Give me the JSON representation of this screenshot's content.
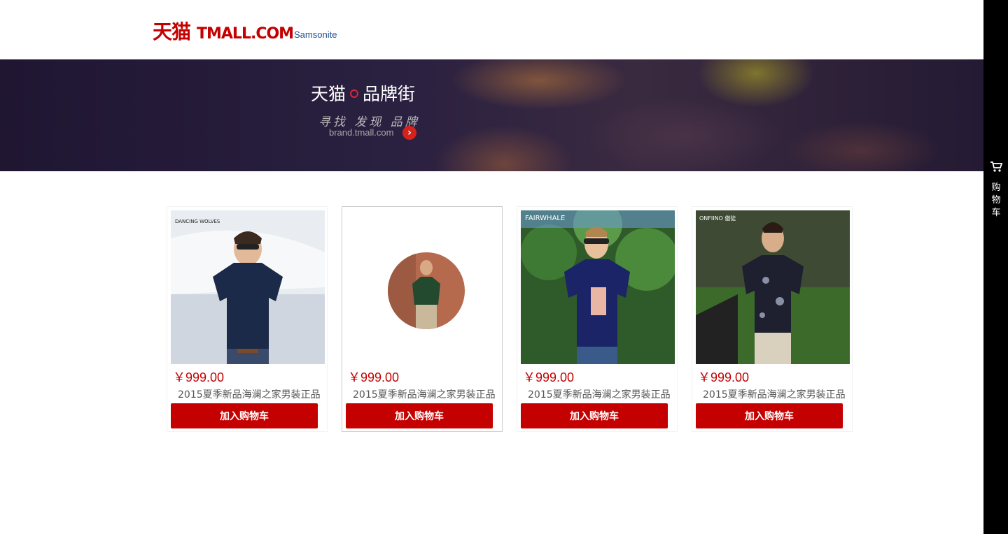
{
  "header": {
    "logo_cn": "天猫",
    "logo_en": "TMALL.COM",
    "brand_logo": "Samsonite"
  },
  "banner": {
    "title_left": "天猫",
    "title_right": "品牌街",
    "subtitle": "寻找 发现 品牌",
    "url": "brand.tmall.com",
    "arrow_icon": "chevron-right-icon"
  },
  "products": [
    {
      "price": "￥999.00",
      "title": "2015夏季新品海澜之家男装正品",
      "button": "加入购物车",
      "brand_mark": "DANCING WOLVES"
    },
    {
      "price": "￥999.00",
      "title": "2015夏季新品海澜之家男装正品",
      "button": "加入购物车"
    },
    {
      "price": "￥999.00",
      "title": "2015夏季新品海澜之家男装正品",
      "button": "加入购物车",
      "brand_mark": "FAIRWHALE"
    },
    {
      "price": "￥999.00",
      "title": "2015夏季新品海澜之家男装正品",
      "button": "加入购物车",
      "brand_mark": "ONFIINO 傲徒"
    }
  ],
  "sidebar": {
    "cart_icon": "cart-icon",
    "cart_label": "购物车"
  },
  "colors": {
    "brand_red": "#c40000",
    "sidebar_bg": "#000000"
  }
}
